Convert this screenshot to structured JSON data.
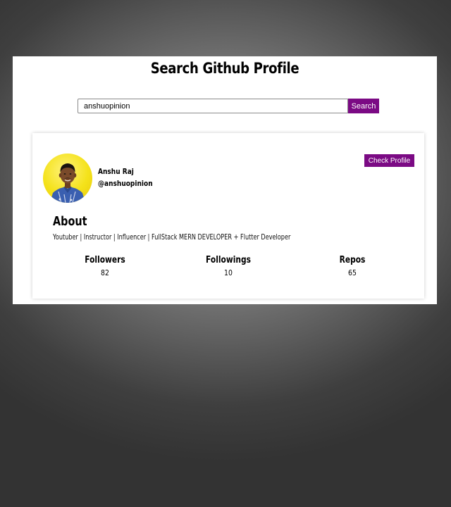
{
  "page": {
    "title": "Search Github Profile"
  },
  "search": {
    "value": "anshuopinion",
    "button_label": "Search"
  },
  "profile": {
    "name": "Anshu Raj",
    "username": "@anshuopinion",
    "check_profile_label": "Check Profile",
    "about_heading": "About",
    "about_text": "Youtuber | Instructor | Influencer | FullStack MERN DEVELOPER + Flutter Developer",
    "stats": [
      {
        "label": "Followers",
        "value": "82"
      },
      {
        "label": "Followings",
        "value": "10"
      },
      {
        "label": "Repos",
        "value": "65"
      }
    ]
  },
  "colors": {
    "accent": "#7b0a84",
    "avatar_background": "#f4e21a"
  },
  "icons": {
    "avatar": "profile-photo"
  }
}
